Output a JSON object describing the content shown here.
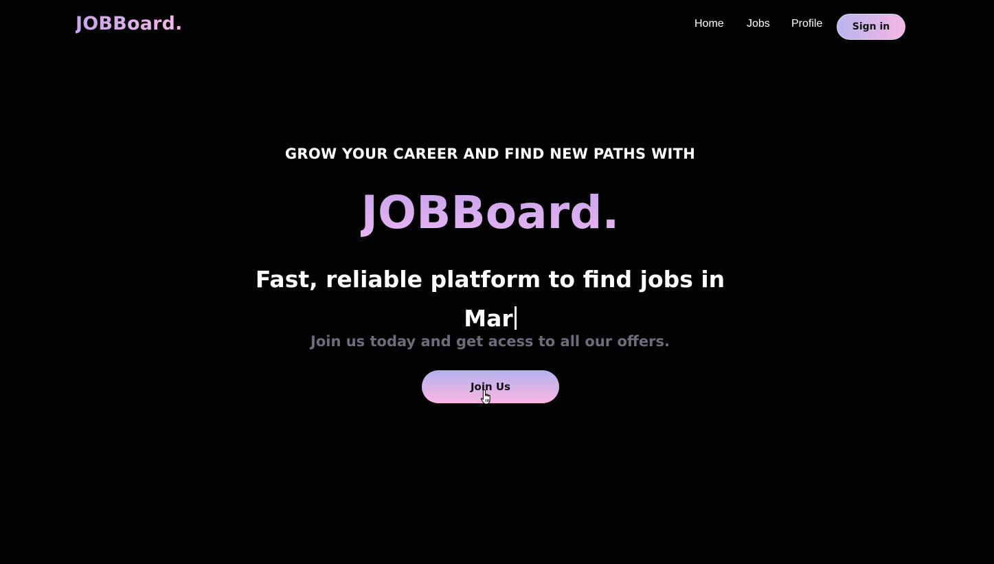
{
  "navbar": {
    "logo": "JOBBoard.",
    "links": [
      {
        "label": "Home"
      },
      {
        "label": "Jobs"
      },
      {
        "label": "Profile"
      }
    ],
    "signin_label": "Sign in"
  },
  "hero": {
    "kicker": "GROW YOUR CAREER AND FIND NEW PATHS WITH",
    "brand": "JOBBoard.",
    "tagline": "Fast, reliable platform to find jobs in",
    "typed_text": "Mar",
    "subtitle": "Join us today and get acess to all our offers.",
    "cta_label": "Join Us"
  },
  "colors": {
    "background": "#030303",
    "gradient_start": "#b3b2ec",
    "gradient_end": "#fbb6e4",
    "subtitle": "#6c6c7a"
  },
  "icons": {
    "pointer": "hand-pointer-cursor-icon"
  }
}
